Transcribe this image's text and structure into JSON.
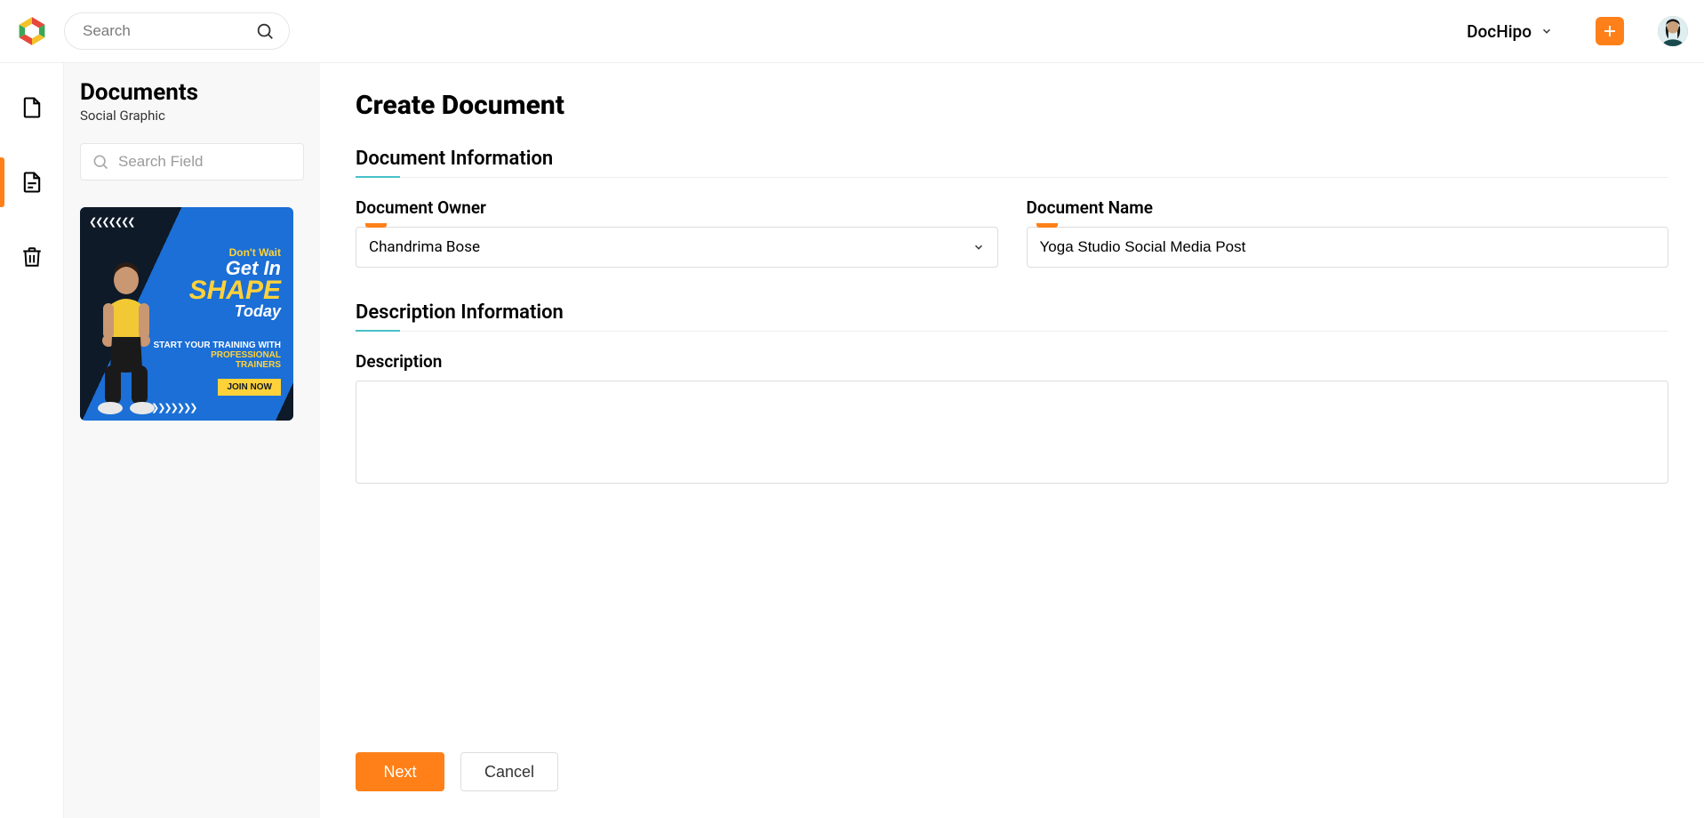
{
  "header": {
    "search_placeholder": "Search",
    "brand_name": "DocHipo"
  },
  "sidebar": {
    "title": "Documents",
    "subtype": "Social Graphic",
    "field_search_placeholder": "Search Field",
    "thumbnail": {
      "line1": "Don't Wait",
      "line2": "Get In",
      "line3": "SHAPE",
      "line4": "Today",
      "sub1": "START YOUR TRAINING WITH",
      "sub2": "PROFESSIONAL",
      "sub3": "TRAINERS",
      "cta": "JOIN NOW"
    }
  },
  "page": {
    "title": "Create Document",
    "sections": {
      "doc_info": "Document Information",
      "desc_info": "Description Information"
    },
    "labels": {
      "owner": "Document Owner",
      "name": "Document Name",
      "description": "Description"
    },
    "values": {
      "owner": "Chandrima Bose",
      "name": "Yoga Studio Social Media Post",
      "description": ""
    },
    "buttons": {
      "next": "Next",
      "cancel": "Cancel"
    }
  }
}
